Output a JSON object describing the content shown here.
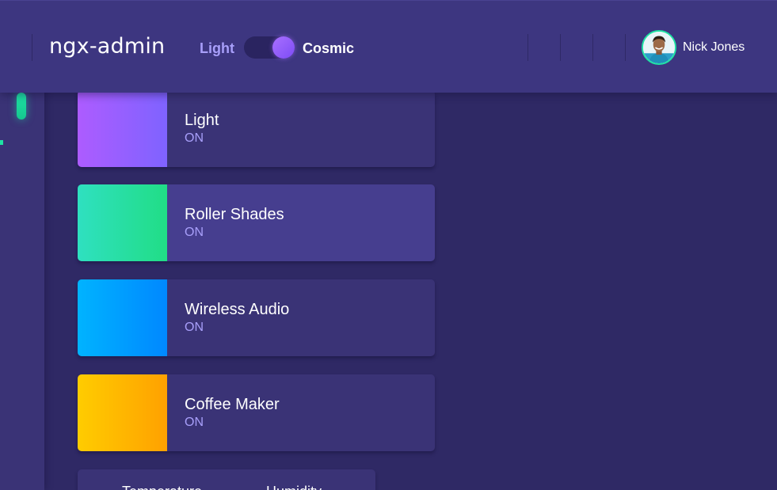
{
  "header": {
    "app_title": "ngx-admin",
    "theme_switcher": {
      "light_label": "Light",
      "cosmic_label": "Cosmic",
      "selected": "Cosmic"
    },
    "user": {
      "name": "Nick Jones"
    }
  },
  "status_cards": [
    {
      "title": "Light",
      "status": "ON",
      "icon": "light-bulb-icon",
      "color": "#ad5cff"
    },
    {
      "title": "Roller Shades",
      "status": "ON",
      "icon": "roller-shades-icon",
      "color": "#2fe0c0"
    },
    {
      "title": "Wireless Audio",
      "status": "ON",
      "icon": "wireless-audio-icon",
      "color": "#00b3ff"
    },
    {
      "title": "Coffee Maker",
      "status": "ON",
      "icon": "coffee-maker-icon",
      "color": "#ffcc00"
    }
  ],
  "bottom_card": {
    "tabs": [
      "Temperature",
      "Humidity"
    ]
  },
  "colors": {
    "background": "#2f2965",
    "header": "#3d3680",
    "card": "#3a3376",
    "accent_green": "#1ee3a4",
    "accent_purple": "#a89ffa"
  }
}
